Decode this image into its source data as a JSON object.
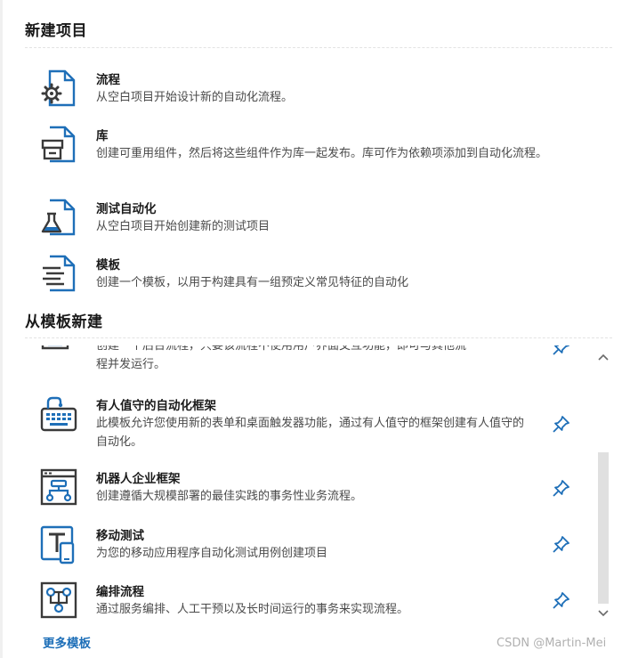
{
  "new_project": {
    "title": "新建项目",
    "items": [
      {
        "icon": "process-gear-icon",
        "title": "流程",
        "desc": "从空白项目开始设计新的自动化流程。"
      },
      {
        "icon": "library-icon",
        "title": "库",
        "desc": "创建可重用组件，然后将这些组件作为库一起发布。库可作为依赖项添加到自动化流程。"
      },
      {
        "icon": "test-flask-icon",
        "title": "测试自动化",
        "desc": "从空白项目开始创建新的测试项目"
      },
      {
        "icon": "template-icon",
        "title": "模板",
        "desc": "创建一个模板，以用于构建具有一组预定义常见特征的自动化"
      }
    ]
  },
  "from_template": {
    "title": "从模板新建",
    "partial_item": {
      "desc_line1": "创建一个后台流程，只要该流程不使用用户界面交互功能，即可与其他流",
      "desc_line2": "程并发运行。"
    },
    "items": [
      {
        "icon": "attended-framework-icon",
        "title": "有人值守的自动化框架",
        "desc": "此模板允许您使用新的表单和桌面触发器功能，通过有人值守的框架创建有人值守的自动化。"
      },
      {
        "icon": "robot-framework-icon",
        "title": "机器人企业框架",
        "desc": "创建遵循大规模部署的最佳实践的事务性业务流程。"
      },
      {
        "icon": "mobile-testing-icon",
        "title": "移动测试",
        "desc": "为您的移动应用程序自动化测试用例创建项目"
      },
      {
        "icon": "orchestration-icon",
        "title": "编排流程",
        "desc": "通过服务编排、人工干预以及长时间运行的事务来实现流程。"
      }
    ],
    "more_link": "更多模板"
  },
  "watermark": "CSDN @Martin-Mei",
  "colors": {
    "accent": "#1e6fb8",
    "icon_dark": "#3a3a3a",
    "text": "#1a1a1a",
    "desc": "#4a4a4a"
  }
}
